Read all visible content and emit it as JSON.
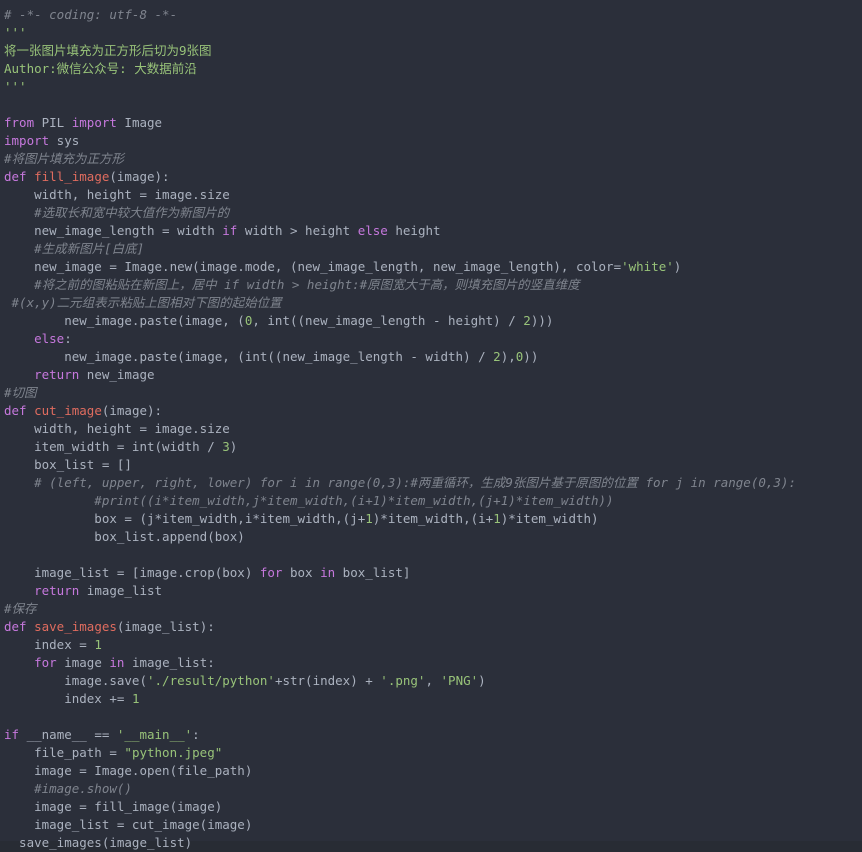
{
  "editor": {
    "language": "Python",
    "theme": "one-dark",
    "background": "#2b2f3a",
    "colors": {
      "keyword": "#c678dd",
      "function": "#e06c5f",
      "identifier": "#abb2bf",
      "string": "#98c379",
      "number": "#98c379",
      "comment": "#7f848e",
      "docstring": "#98c379"
    }
  },
  "code": {
    "lines": [
      {
        "n": 1,
        "tokens": [
          {
            "t": "cmt",
            "v": "# -*- coding: utf-8 -*-"
          }
        ]
      },
      {
        "n": 2,
        "tokens": [
          {
            "t": "doc",
            "v": "'''"
          }
        ]
      },
      {
        "n": 3,
        "tokens": [
          {
            "t": "doc",
            "v": "将一张图片填充为正方形后切为9张图"
          }
        ]
      },
      {
        "n": 4,
        "tokens": [
          {
            "t": "doc",
            "v": "Author:微信公众号: 大数据前沿"
          }
        ]
      },
      {
        "n": 5,
        "tokens": [
          {
            "t": "doc",
            "v": "'''"
          }
        ]
      },
      {
        "n": 6,
        "tokens": []
      },
      {
        "n": 7,
        "tokens": [
          {
            "t": "kw",
            "v": "from"
          },
          {
            "t": "id",
            "v": " PIL "
          },
          {
            "t": "kw",
            "v": "import"
          },
          {
            "t": "id",
            "v": " Image"
          }
        ]
      },
      {
        "n": 8,
        "tokens": [
          {
            "t": "kw",
            "v": "import"
          },
          {
            "t": "id",
            "v": " sys"
          }
        ]
      },
      {
        "n": 9,
        "tokens": [
          {
            "t": "cmt",
            "v": "#将图片填充为正方形"
          }
        ]
      },
      {
        "n": 10,
        "tokens": [
          {
            "t": "kw",
            "v": "def"
          },
          {
            "t": "id",
            "v": " "
          },
          {
            "t": "fn",
            "v": "fill_image"
          },
          {
            "t": "op",
            "v": "(image):"
          }
        ]
      },
      {
        "n": 11,
        "tokens": [
          {
            "t": "id",
            "v": "    width, height = image.size"
          }
        ]
      },
      {
        "n": 12,
        "tokens": [
          {
            "t": "cmt",
            "v": "    #选取长和宽中较大值作为新图片的"
          }
        ]
      },
      {
        "n": 13,
        "tokens": [
          {
            "t": "id",
            "v": "    new_image_length = width "
          },
          {
            "t": "kw",
            "v": "if"
          },
          {
            "t": "id",
            "v": " width > height "
          },
          {
            "t": "kw",
            "v": "else"
          },
          {
            "t": "id",
            "v": " height"
          }
        ]
      },
      {
        "n": 14,
        "tokens": [
          {
            "t": "cmt",
            "v": "    #生成新图片[白底]"
          }
        ]
      },
      {
        "n": 15,
        "tokens": [
          {
            "t": "id",
            "v": "    new_image = Image.new(image.mode, (new_image_length, new_image_length), color="
          },
          {
            "t": "str",
            "v": "'white'"
          },
          {
            "t": "op",
            "v": ")"
          }
        ]
      },
      {
        "n": 16,
        "tokens": [
          {
            "t": "cmt",
            "v": "    #将之前的图粘贴在新图上，居中 if width > height:#原图宽大于高，则填充图片的竖直维度"
          }
        ]
      },
      {
        "n": 17,
        "tokens": [
          {
            "t": "cmt",
            "v": " #(x,y)二元组表示粘贴上图相对下图的起始位置"
          }
        ]
      },
      {
        "n": 18,
        "tokens": [
          {
            "t": "id",
            "v": "        new_image.paste(image, ("
          },
          {
            "t": "num",
            "v": "0"
          },
          {
            "t": "id",
            "v": ", int((new_image_length - height) / "
          },
          {
            "t": "num",
            "v": "2"
          },
          {
            "t": "op",
            "v": ")))"
          }
        ]
      },
      {
        "n": 19,
        "tokens": [
          {
            "t": "id",
            "v": "    "
          },
          {
            "t": "kw",
            "v": "else"
          },
          {
            "t": "op",
            "v": ":"
          }
        ]
      },
      {
        "n": 20,
        "tokens": [
          {
            "t": "id",
            "v": "        new_image.paste(image, (int((new_image_length - width) / "
          },
          {
            "t": "num",
            "v": "2"
          },
          {
            "t": "id",
            "v": "),"
          },
          {
            "t": "num",
            "v": "0"
          },
          {
            "t": "op",
            "v": "))"
          }
        ]
      },
      {
        "n": 21,
        "tokens": [
          {
            "t": "id",
            "v": "    "
          },
          {
            "t": "kw",
            "v": "return"
          },
          {
            "t": "id",
            "v": " new_image"
          }
        ]
      },
      {
        "n": 22,
        "tokens": [
          {
            "t": "cmt",
            "v": "#切图"
          }
        ]
      },
      {
        "n": 23,
        "tokens": [
          {
            "t": "kw",
            "v": "def"
          },
          {
            "t": "id",
            "v": " "
          },
          {
            "t": "fn",
            "v": "cut_image"
          },
          {
            "t": "op",
            "v": "(image):"
          }
        ]
      },
      {
        "n": 24,
        "tokens": [
          {
            "t": "id",
            "v": "    width, height = image.size"
          }
        ]
      },
      {
        "n": 25,
        "tokens": [
          {
            "t": "id",
            "v": "    item_width = int(width / "
          },
          {
            "t": "num",
            "v": "3"
          },
          {
            "t": "op",
            "v": ")"
          }
        ]
      },
      {
        "n": 26,
        "tokens": [
          {
            "t": "id",
            "v": "    box_list = []"
          }
        ]
      },
      {
        "n": 27,
        "tokens": [
          {
            "t": "cmt",
            "v": "    # (left, upper, right, lower) for i in range(0,3):#两重循环，生成9张图片基于原图的位置 for j in range(0,3):"
          }
        ]
      },
      {
        "n": 28,
        "tokens": [
          {
            "t": "cmt",
            "v": "            #print((i*item_width,j*item_width,(i+1)*item_width,(j+1)*item_width))"
          }
        ]
      },
      {
        "n": 29,
        "tokens": [
          {
            "t": "id",
            "v": "            box = (j*item_width,i*item_width,(j+"
          },
          {
            "t": "num",
            "v": "1"
          },
          {
            "t": "id",
            "v": ")*item_width,(i+"
          },
          {
            "t": "num",
            "v": "1"
          },
          {
            "t": "op",
            "v": ")*item_width)"
          }
        ]
      },
      {
        "n": 30,
        "tokens": [
          {
            "t": "id",
            "v": "            box_list.append(box)"
          }
        ]
      },
      {
        "n": 31,
        "tokens": []
      },
      {
        "n": 32,
        "tokens": [
          {
            "t": "id",
            "v": "    image_list = [image.crop(box) "
          },
          {
            "t": "kw",
            "v": "for"
          },
          {
            "t": "id",
            "v": " box "
          },
          {
            "t": "kw",
            "v": "in"
          },
          {
            "t": "id",
            "v": " box_list]"
          }
        ]
      },
      {
        "n": 33,
        "tokens": [
          {
            "t": "id",
            "v": "    "
          },
          {
            "t": "kw",
            "v": "return"
          },
          {
            "t": "id",
            "v": " image_list"
          }
        ]
      },
      {
        "n": 34,
        "tokens": [
          {
            "t": "cmt",
            "v": "#保存"
          }
        ]
      },
      {
        "n": 35,
        "tokens": [
          {
            "t": "kw",
            "v": "def"
          },
          {
            "t": "id",
            "v": " "
          },
          {
            "t": "fn",
            "v": "save_images"
          },
          {
            "t": "op",
            "v": "(image_list):"
          }
        ]
      },
      {
        "n": 36,
        "tokens": [
          {
            "t": "id",
            "v": "    index = "
          },
          {
            "t": "num",
            "v": "1"
          }
        ]
      },
      {
        "n": 37,
        "tokens": [
          {
            "t": "id",
            "v": "    "
          },
          {
            "t": "kw",
            "v": "for"
          },
          {
            "t": "id",
            "v": " image "
          },
          {
            "t": "kw",
            "v": "in"
          },
          {
            "t": "id",
            "v": " image_list:"
          }
        ]
      },
      {
        "n": 38,
        "tokens": [
          {
            "t": "id",
            "v": "        image.save("
          },
          {
            "t": "str",
            "v": "'./result/python'"
          },
          {
            "t": "id",
            "v": "+str(index) + "
          },
          {
            "t": "str",
            "v": "'.png'"
          },
          {
            "t": "id",
            "v": ", "
          },
          {
            "t": "str",
            "v": "'PNG'"
          },
          {
            "t": "op",
            "v": ")"
          }
        ]
      },
      {
        "n": 39,
        "tokens": [
          {
            "t": "id",
            "v": "        index += "
          },
          {
            "t": "num",
            "v": "1"
          }
        ]
      },
      {
        "n": 40,
        "tokens": []
      },
      {
        "n": 41,
        "tokens": [
          {
            "t": "kw",
            "v": "if"
          },
          {
            "t": "id",
            "v": " __name__ == "
          },
          {
            "t": "str",
            "v": "'__main__'"
          },
          {
            "t": "op",
            "v": ":"
          }
        ]
      },
      {
        "n": 42,
        "tokens": [
          {
            "t": "id",
            "v": "    file_path = "
          },
          {
            "t": "str",
            "v": "\"python.jpeg\""
          }
        ]
      },
      {
        "n": 43,
        "tokens": [
          {
            "t": "id",
            "v": "    image = Image.open(file_path)"
          }
        ]
      },
      {
        "n": 44,
        "tokens": [
          {
            "t": "cmt",
            "v": "    #image.show()"
          }
        ]
      },
      {
        "n": 45,
        "tokens": [
          {
            "t": "id",
            "v": "    image = fill_image(image)"
          }
        ]
      },
      {
        "n": 46,
        "tokens": [
          {
            "t": "id",
            "v": "    image_list = cut_image(image)"
          }
        ]
      },
      {
        "n": 47,
        "tokens": [
          {
            "t": "id",
            "v": "  save_images(image_list)"
          }
        ]
      }
    ]
  }
}
